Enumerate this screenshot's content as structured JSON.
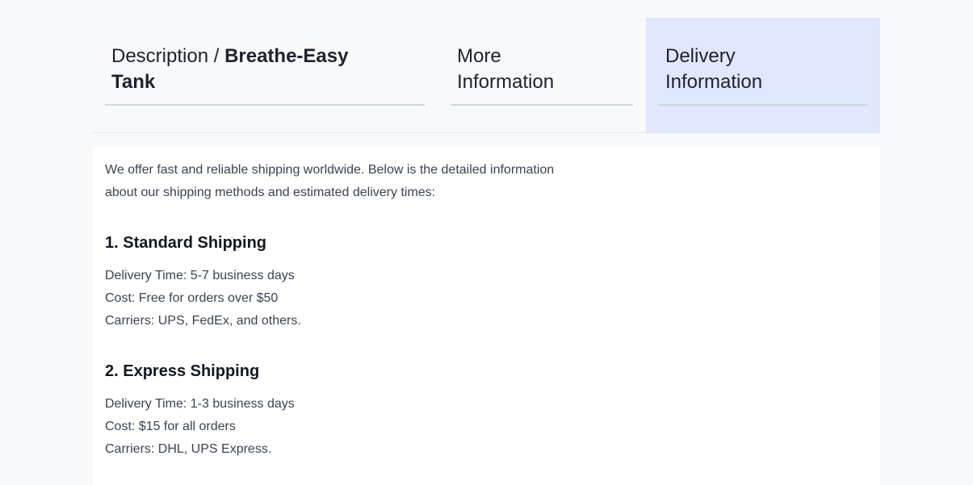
{
  "tabs": {
    "description": {
      "prefix": "Description / ",
      "product": "Breathe-Easy Tank"
    },
    "more_info": {
      "label": "More Information"
    },
    "delivery": {
      "label": "Delivery Information"
    }
  },
  "delivery": {
    "intro": "We offer fast and reliable shipping worldwide. Below is the detailed information about our shipping methods and estimated delivery times:",
    "sections": [
      {
        "title": "1. Standard Shipping",
        "lines": [
          "Delivery Time: 5-7 business days",
          "Cost: Free for orders over $50",
          "Carriers: UPS, FedEx, and others."
        ]
      },
      {
        "title": "2. Express Shipping",
        "lines": [
          "Delivery Time: 1-3 business days",
          "Cost: $15 for all orders",
          "Carriers: DHL, UPS Express."
        ]
      }
    ]
  }
}
